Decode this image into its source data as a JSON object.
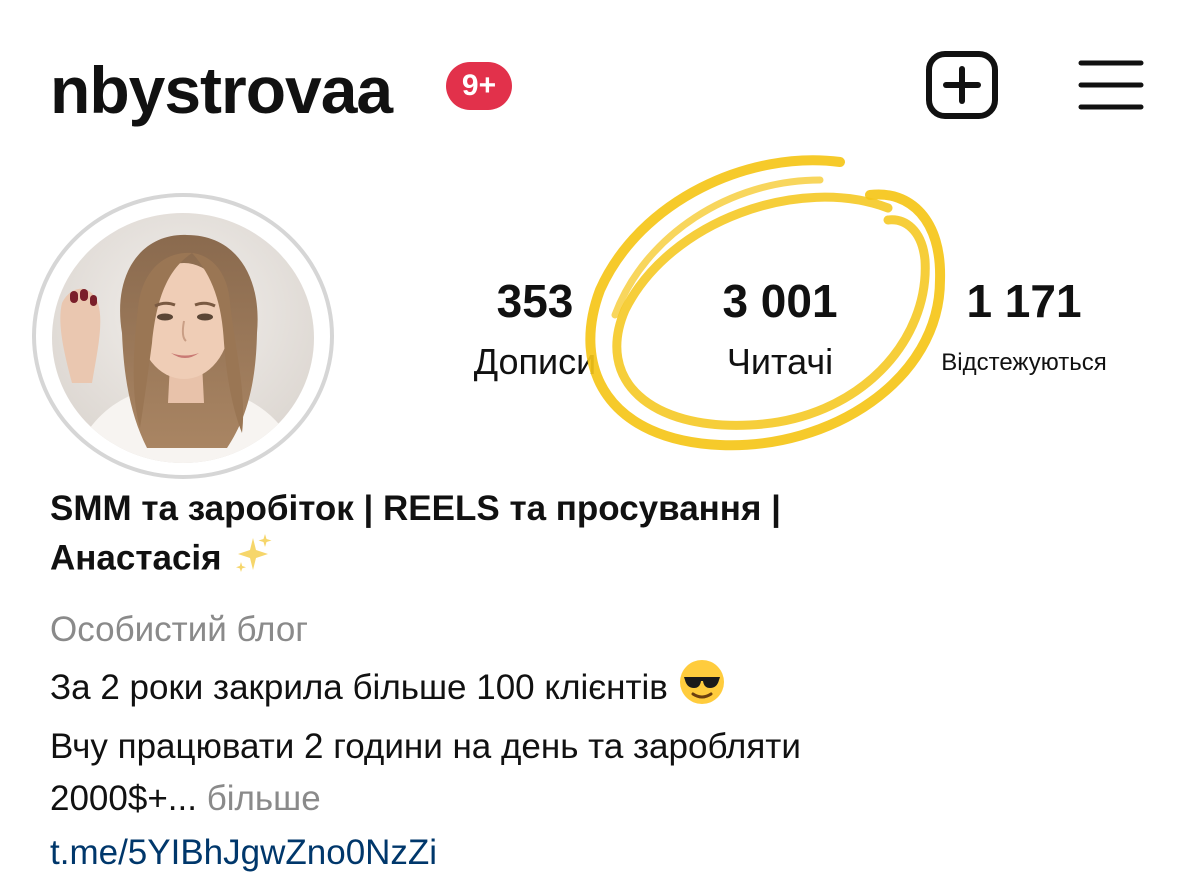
{
  "header": {
    "username": "nbystrovaa",
    "notification_badge": "9+",
    "badge_color": "#e2314b",
    "new_post_icon": "plus-square-icon",
    "menu_icon": "hamburger-menu-icon"
  },
  "profile": {
    "avatar": "profile-photo",
    "stats": {
      "posts": {
        "value": "353",
        "label": "Дописи"
      },
      "followers": {
        "value": "3 001",
        "label": "Читачі"
      },
      "following": {
        "value": "1 171",
        "label": "Відстежуються"
      }
    },
    "highlight_color": "#f5c518"
  },
  "bio": {
    "name_line1": "SMM та заробіток | REELS та просування |",
    "name_line2": "Анастасія",
    "name_emoji": "sparkles",
    "category": "Особистий блог",
    "line1": "За 2 роки закрила більше 100 клієнтів",
    "line1_emoji": "smiling-face-with-sunglasses",
    "line2": "Вчу працювати 2 години на день та заробляти",
    "line3": "2000$+...",
    "more_label": "більше",
    "link": "t.me/5YIBhJgwZno0NzZi",
    "link_color": "#00376b"
  }
}
